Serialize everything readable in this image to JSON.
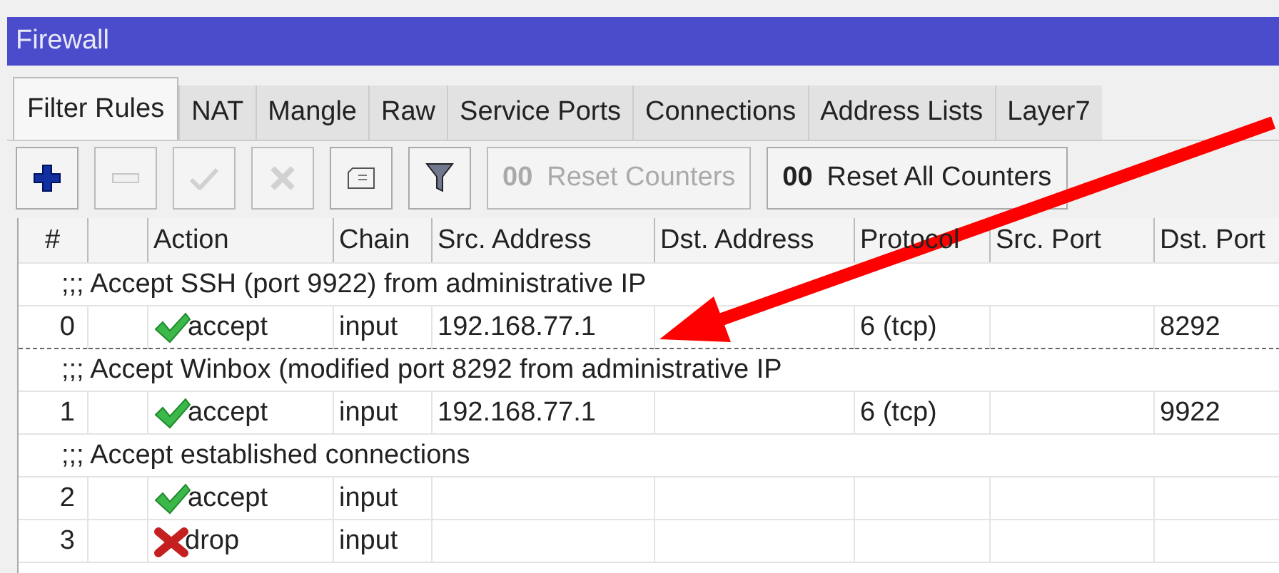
{
  "window": {
    "title": "Firewall"
  },
  "tabs": [
    {
      "label": "Filter Rules",
      "selected": true
    },
    {
      "label": "NAT",
      "selected": false
    },
    {
      "label": "Mangle",
      "selected": false
    },
    {
      "label": "Raw",
      "selected": false
    },
    {
      "label": "Service Ports",
      "selected": false
    },
    {
      "label": "Connections",
      "selected": false
    },
    {
      "label": "Address Lists",
      "selected": false
    },
    {
      "label": "Layer7",
      "selected": false
    }
  ],
  "toolbar": [
    {
      "kind": "add",
      "disabled": false
    },
    {
      "kind": "remove",
      "disabled": true
    },
    {
      "kind": "enable",
      "disabled": true
    },
    {
      "kind": "disable",
      "disabled": true
    },
    {
      "kind": "comment",
      "disabled": false
    },
    {
      "kind": "filter",
      "disabled": false
    },
    {
      "kind": "text",
      "prefix": "00",
      "label": "Reset Counters",
      "disabled": true
    },
    {
      "kind": "text",
      "prefix": "00",
      "label": "Reset All Counters",
      "disabled": false
    }
  ],
  "table": {
    "columns": [
      "#",
      "",
      "Action",
      "Chain",
      "Src. Address",
      "Dst. Address",
      "Protocol",
      "Src. Port",
      "Dst. Port"
    ],
    "rows": [
      {
        "kind": "comment",
        "text": ";;; Accept SSH (port 9922) from administrative IP"
      },
      {
        "kind": "rule",
        "selected": true,
        "number": "0",
        "action": "accept",
        "allowed": true,
        "chain": "input",
        "src_address": "192.168.77.1",
        "protocol": "6 (tcp)",
        "dst_port": "8292"
      },
      {
        "kind": "comment",
        "text": ";;; Accept Winbox (modified port 8292 from administrative IP"
      },
      {
        "kind": "rule",
        "selected": false,
        "number": "1",
        "action": "accept",
        "allowed": true,
        "chain": "input",
        "src_address": "192.168.77.1",
        "protocol": "6 (tcp)",
        "dst_port": "9922"
      },
      {
        "kind": "comment",
        "text": ";;; Accept established connections"
      },
      {
        "kind": "rule",
        "selected": false,
        "number": "2",
        "action": "accept",
        "allowed": true,
        "chain": "input"
      },
      {
        "kind": "rule",
        "selected": false,
        "number": "3",
        "action": "drop",
        "allowed": false,
        "chain": "input"
      }
    ]
  }
}
